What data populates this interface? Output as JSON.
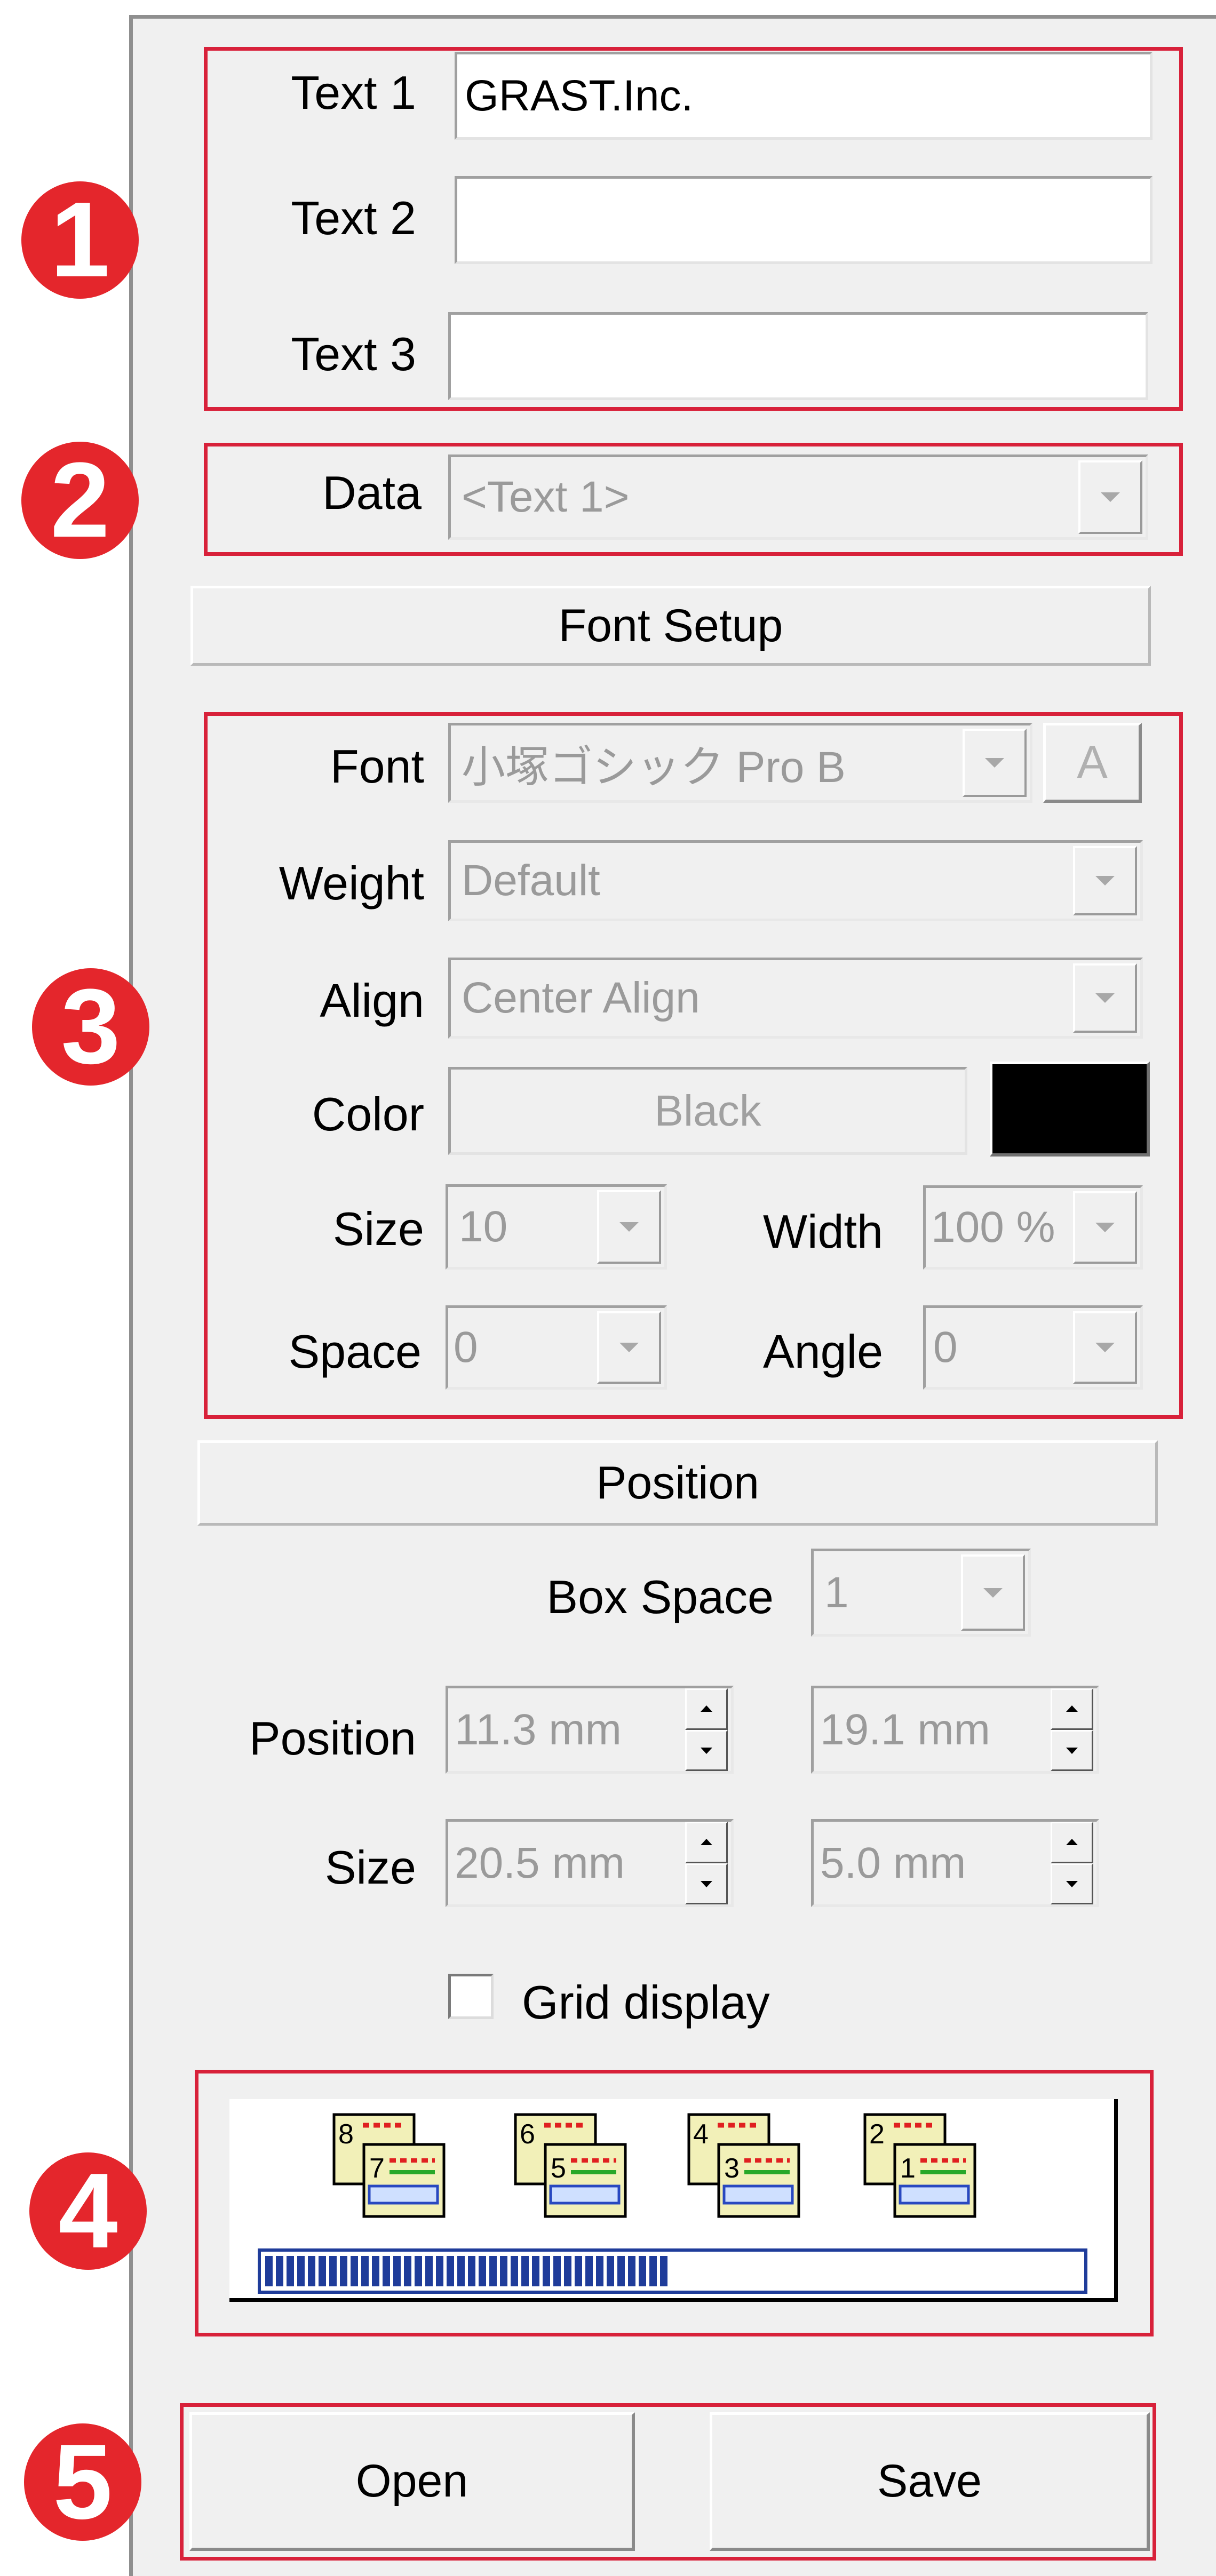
{
  "badges": [
    "1",
    "2",
    "3",
    "4",
    "5"
  ],
  "text_section": {
    "text1_label": "Text 1",
    "text1_value": "GRAST.Inc.",
    "text2_label": "Text 2",
    "text2_value": "",
    "text3_label": "Text 3",
    "text3_value": ""
  },
  "data_section": {
    "label": "Data",
    "value": "<Text 1>"
  },
  "font_setup": {
    "header": "Font Setup",
    "font_label": "Font",
    "font_value": "小塚ゴシック Pro B",
    "font_button": "A",
    "weight_label": "Weight",
    "weight_value": "Default",
    "align_label": "Align",
    "align_value": "Center Align",
    "color_label": "Color",
    "color_value": "Black",
    "color_swatch": "#000000",
    "size_label": "Size",
    "size_value": "10",
    "width_label": "Width",
    "width_value": "100 %",
    "space_label": "Space",
    "space_value": "0",
    "angle_label": "Angle",
    "angle_value": "0"
  },
  "position_section": {
    "header": "Position",
    "box_space_label": "Box Space",
    "box_space_value": "1",
    "position_label": "Position",
    "position_x": "11.3 mm",
    "position_y": "19.1 mm",
    "size_label": "Size",
    "size_w": "20.5 mm",
    "size_h": "5.0 mm",
    "grid_label": "Grid display",
    "grid_checked": false
  },
  "layout_thumbs": {
    "pairs": [
      [
        "8",
        "7"
      ],
      [
        "6",
        "5"
      ],
      [
        "4",
        "3"
      ],
      [
        "2",
        "1"
      ]
    ],
    "progress": 0.5
  },
  "buttons": {
    "open": "Open",
    "save": "Save"
  },
  "colors": {
    "panel_bg": "#f0f0f0",
    "highlight_red": "#d8213a",
    "badge_red": "#e4262c",
    "progress_blue": "#1f3c9a"
  }
}
